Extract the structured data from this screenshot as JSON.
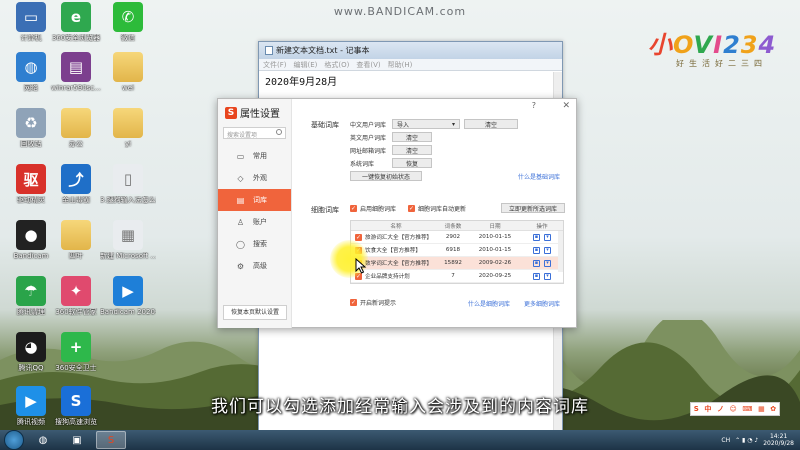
{
  "watermark": "www.BANDICAM.com",
  "desktop": {
    "icons": [
      {
        "label": "计算机",
        "glyph": "▭",
        "color": "#3b6fb5",
        "icon": "computer-icon"
      },
      {
        "label": "360安全浏览器",
        "glyph": "e",
        "color": "#2fa84f",
        "icon": "browser-360-icon"
      },
      {
        "label": "微信",
        "glyph": "✆",
        "color": "#2dbb3a",
        "icon": "wechat-icon"
      },
      {
        "label": "网络",
        "glyph": "◍",
        "color": "#2f7fd0",
        "icon": "network-icon"
      },
      {
        "label": "winrar590sc...",
        "glyph": "▤",
        "color": "#7c3f8e",
        "icon": "winrar-icon"
      },
      {
        "label": "wei",
        "glyph": "",
        "color": "",
        "icon": "folder-icon"
      },
      {
        "label": "回收站",
        "glyph": "♻",
        "color": "#8fa3b8",
        "icon": "recycle-bin-icon"
      },
      {
        "label": "办公",
        "glyph": "",
        "color": "",
        "icon": "folder-icon"
      },
      {
        "label": "yi",
        "glyph": "",
        "color": "",
        "icon": "folder-icon"
      },
      {
        "label": "驱动精灵",
        "glyph": "驱",
        "color": "#d8312a",
        "icon": "driver-genius-icon"
      },
      {
        "label": "金山毒霸",
        "glyph": "⤴",
        "color": "#1f6fc8",
        "icon": "kingsoft-antivirus-icon"
      },
      {
        "label": "3.搜狗输入法怎么设置.txt",
        "glyph": "▯",
        "color": "#e9ecef",
        "icon": "text-file-icon"
      },
      {
        "label": "Bandicam",
        "glyph": "●",
        "color": "#222",
        "icon": "bandicam-icon"
      },
      {
        "label": "四叶",
        "glyph": "",
        "color": "",
        "icon": "folder-icon"
      },
      {
        "label": "新建 Microsoft ...",
        "glyph": "▦",
        "color": "#e9ecef",
        "icon": "ms-document-icon"
      },
      {
        "label": "腾讯清理",
        "glyph": "☂",
        "color": "#2aa44a",
        "icon": "tencent-cleaner-icon"
      },
      {
        "label": "360软件管家",
        "glyph": "✦",
        "color": "#e04a6e",
        "icon": "software-manager-icon"
      },
      {
        "label": "Bandicam 2020-09-2...",
        "glyph": "▶",
        "color": "#1e7fd8",
        "icon": "video-file-icon"
      },
      {
        "label": "腾讯QQ",
        "glyph": "◕",
        "color": "#1c1c1c",
        "icon": "qq-icon"
      },
      {
        "label": "360安全卫士",
        "glyph": "+",
        "color": "#2eb84b",
        "icon": "security-guard-icon"
      },
      {
        "label": "腾讯视频",
        "glyph": "▶",
        "color": "#1e90e8",
        "icon": "tencent-video-icon"
      },
      {
        "label": "搜狗高速浏览",
        "glyph": "S",
        "color": "#1a6fd8",
        "icon": "sogou-browser-icon"
      }
    ]
  },
  "logo": {
    "brand": "小OVI234",
    "slogan": "好生活好二三四"
  },
  "notepad": {
    "title": "新建文本文档.txt - 记事本",
    "menu": [
      "文件(F)",
      "编辑(E)",
      "格式(O)",
      "查看(V)",
      "帮助(H)"
    ],
    "content": "2020年9月28月"
  },
  "dialog": {
    "title": "属性设置",
    "help": "?",
    "close": "✕",
    "search_placeholder": "搜索设置项",
    "nav": [
      {
        "label": "常用",
        "glyph": "▭",
        "icon": "monitor-icon",
        "active": false
      },
      {
        "label": "外观",
        "glyph": "◇",
        "icon": "appearance-icon",
        "active": false
      },
      {
        "label": "词库",
        "glyph": "▤",
        "icon": "dictionary-icon",
        "active": true
      },
      {
        "label": "账户",
        "glyph": "♙",
        "icon": "account-icon",
        "active": false
      },
      {
        "label": "搜索",
        "glyph": "◯",
        "icon": "search-icon",
        "active": false
      },
      {
        "label": "高级",
        "glyph": "⚙",
        "icon": "gear-icon",
        "active": false
      }
    ],
    "reset_label": "恢复本页默认设置",
    "basic": {
      "section_label": "基础词库",
      "rows": [
        {
          "label": "中文用户词库",
          "action": "导入",
          "extra": "清空"
        },
        {
          "label": "英文用户词库",
          "action": "清空"
        },
        {
          "label": "网址邮箱词库",
          "action": "清空"
        },
        {
          "label": "系统词库",
          "action": "恢复"
        }
      ],
      "restore_all": "一键恢复初始状态",
      "link": "什么是基础词库"
    },
    "cell": {
      "section_label": "细胞词库",
      "enable_label": "启用细胞词库",
      "auto_update_label": "细胞词库自动更新",
      "update_button": "立即更新所选词库",
      "columns": [
        "名称",
        "词条数",
        "日期",
        "操作"
      ],
      "rows": [
        {
          "name": "旅游词汇大全【官方推荐】",
          "count": "2902",
          "date": "2010-01-15",
          "checked": true,
          "highlight": false
        },
        {
          "name": "饮食大全【官方推荐】",
          "count": "6918",
          "date": "2010-01-15",
          "checked": true,
          "highlight": false
        },
        {
          "name": "数学词汇大全【官方推荐】",
          "count": "15892",
          "date": "2009-02-26",
          "checked": true,
          "highlight": true
        },
        {
          "name": "企业品牌支持计划",
          "count": "7",
          "date": "2020-09-25",
          "checked": true,
          "highlight": false
        }
      ],
      "new_tip_label": "开启新词提示",
      "link_what": "什么是细胞词库",
      "link_more": "更多细胞词库"
    }
  },
  "subtitle": "我们可以勾选添加经常输入会涉及到的内容词库",
  "ime": {
    "items": [
      "S",
      "中",
      "ノ",
      "☺",
      "⌨",
      "▦",
      "✿"
    ]
  },
  "taskbar": {
    "apps": [
      {
        "glyph": "◍",
        "icon": "ie-icon",
        "active": false
      },
      {
        "glyph": "▣",
        "icon": "explorer-icon",
        "active": false
      },
      {
        "glyph": "S",
        "icon": "sogou-input-icon",
        "active": true
      }
    ],
    "tray_lang": "CH",
    "time": "14:21",
    "date": "2020/9/28"
  }
}
